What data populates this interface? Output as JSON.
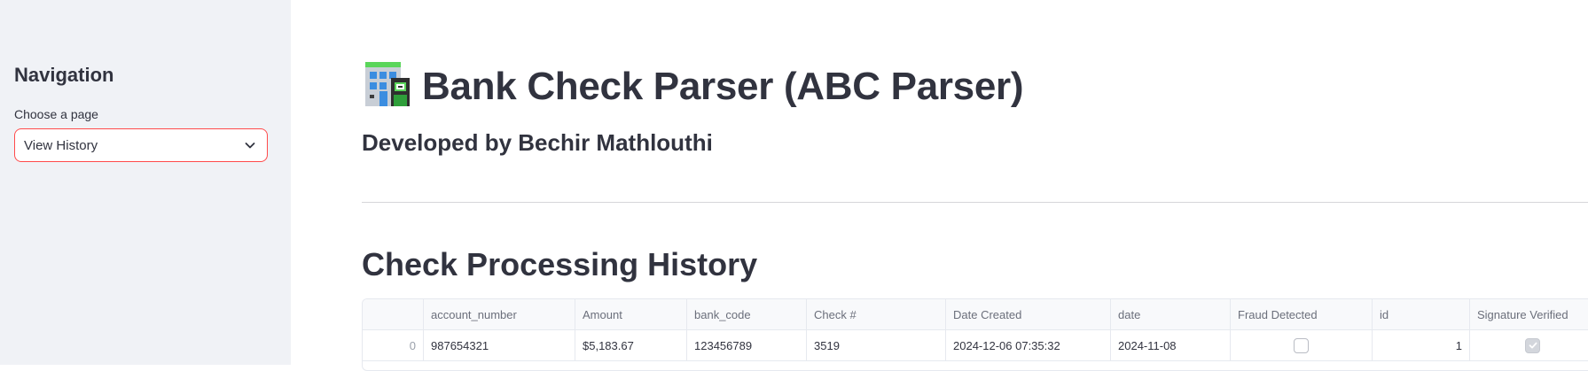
{
  "sidebar": {
    "title": "Navigation",
    "select_label": "Choose a page",
    "selected_page": "View History"
  },
  "header": {
    "title": "Bank Check Parser (ABC Parser)",
    "title_icon": "office-building-emoji",
    "subtitle": "Developed by Bechir Mathlouthi"
  },
  "history": {
    "title": "Check Processing History",
    "columns": [
      "account_number",
      "Amount",
      "bank_code",
      "Check #",
      "Date Created",
      "date",
      "Fraud Detected",
      "id",
      "Signature Verified"
    ],
    "rows": [
      {
        "index": "0",
        "account_number": "987654321",
        "amount": "$5,183.67",
        "bank_code": "123456789",
        "check_no": "3519",
        "date_created": "2024-12-06 07:35:32",
        "date": "2024-11-08",
        "fraud_detected": false,
        "id": "1",
        "signature_verified": true
      }
    ]
  },
  "colors": {
    "accent": "#ff4b4b",
    "sidebar_bg": "#f0f2f6",
    "text": "#31333f"
  }
}
